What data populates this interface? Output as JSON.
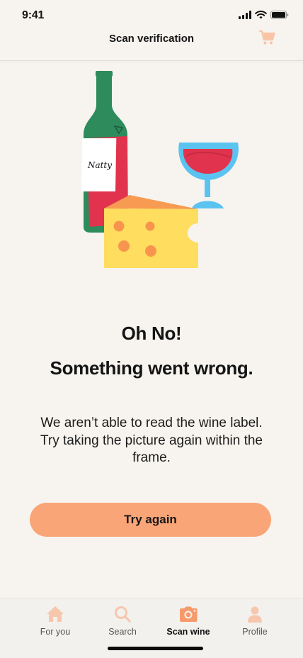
{
  "status_bar": {
    "time": "9:41"
  },
  "header": {
    "title": "Scan verification"
  },
  "illustration": {
    "bottle_label": "Natty"
  },
  "error": {
    "title_line1": "Oh No!",
    "title_line2": "Something went wrong.",
    "message": "We aren’t able to read the wine label. Try taking the picture again within the frame."
  },
  "actions": {
    "try_again_label": "Try again"
  },
  "tab_bar": {
    "active": "Scan wine",
    "tabs": [
      {
        "label": "For you",
        "icon": "home-icon"
      },
      {
        "label": "Search",
        "icon": "search-icon"
      },
      {
        "label": "Scan wine",
        "icon": "camera-icon"
      },
      {
        "label": "Profile",
        "icon": "person-icon"
      }
    ]
  },
  "colors": {
    "background": "#F7F4EF",
    "accent": "#F9A578",
    "bottle": "#2E8B5C",
    "wine": "#E1334E",
    "glass": "#5BC3F0",
    "cheese": "#FFDD5E"
  }
}
